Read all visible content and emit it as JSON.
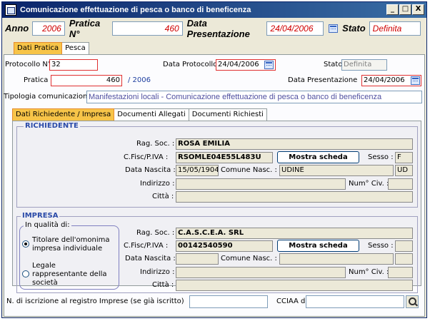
{
  "window": {
    "title": "Comunicazione effettuazione di pesca o banco di beneficenza",
    "min_label": "_",
    "max_label": "□",
    "close_label": "X"
  },
  "header": {
    "anno_label": "Anno",
    "anno_value": "2006",
    "pratica_label": "Pratica N°",
    "pratica_value": "460",
    "data_presentazione_label": "Data Presentazione",
    "data_presentazione_value": "24/04/2006",
    "stato_label": "Stato",
    "stato_value": "Definita"
  },
  "tabs": [
    "Dati Pratica",
    "Pesca"
  ],
  "dati_pratica": {
    "protocollo_label": "Protocollo N°",
    "protocollo_value": "32",
    "data_protocollo_label": "Data Protocollo",
    "data_protocollo_value": "24/04/2006",
    "stato_label": "Stato",
    "stato_value": "Definita",
    "pratica_label": "Pratica N°",
    "pratica_value": "460",
    "pratica_year": "/ 2006",
    "data_presentazione_label": "Data Presentazione",
    "data_presentazione_value": "24/04/2006",
    "tipologia_label": "Tipologia comunicazione",
    "tipologia_value": "Manifestazioni locali - Comunicazione effettuazione di pesca o banco di beneficenza"
  },
  "subtabs": [
    "Dati Richiedente / Impresa",
    "Documenti Allegati",
    "Documenti Richiesti"
  ],
  "richiedente": {
    "group_label": "RICHIEDENTE",
    "rag_soc_label": "Rag. Soc. :",
    "rag_soc_value": "ROSA EMILIA",
    "cf_label": "C.Fisc/P.IVA :",
    "cf_value": "RSOMLE04E55L483U",
    "mostra_label": "Mostra scheda",
    "sesso_label": "Sesso :",
    "sesso_value": "F",
    "data_nascita_label": "Data Nascita :",
    "data_nascita_value": "15/05/1904",
    "comune_label": "Comune Nasc. :",
    "comune_value": "UDINE",
    "prov_value": "UD",
    "indirizzo_label": "Indirizzo :",
    "numciv_label": "Num° Civ. :",
    "citta_label": "Città :"
  },
  "impresa": {
    "group_label": "IMPRESA",
    "qualita_label": "In qualità di:",
    "option1": "Titolare dell'omonima impresa individuale",
    "option2": "Legale rappresentante della società",
    "rag_soc_label": "Rag. Soc. :",
    "rag_soc_value": "C.A.S.C.E.A. SRL",
    "cf_label": "C.Fisc/P.IVA :",
    "cf_value": "00142540590",
    "mostra_label": "Mostra scheda",
    "sesso_label": "Sesso :",
    "data_nascita_label": "Data Nascita :",
    "comune_label": "Comune Nasc. :",
    "indirizzo_label": "Indirizzo :",
    "numciv_label": "Num° Civ. :",
    "citta_label": "Città :"
  },
  "footer": {
    "iscrizione_label": "N. di iscrizione al registro Imprese (se già iscritto)",
    "cciaa_label": "CCIAA di"
  }
}
